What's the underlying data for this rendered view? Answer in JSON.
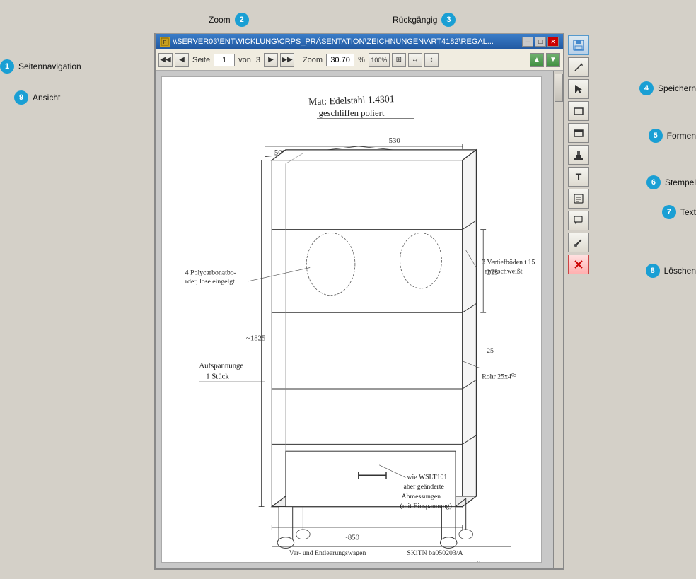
{
  "window": {
    "title": "\\\\SERVER03\\ENTWICKLUNG\\CRPS_PRÄSENTATION\\ZEICHNUNGEN\\ART4182\\REGAL...",
    "icon": "📄"
  },
  "toolbar": {
    "page_label": "Seite",
    "page_current": "1",
    "page_of_label": "von",
    "page_total": "3",
    "zoom_label": "Zoom",
    "zoom_value": "30.70",
    "zoom_percent": "%",
    "btn_first": "◀◀",
    "btn_prev": "◀",
    "btn_next": "▶",
    "btn_last": "▶▶",
    "btn_100": "100%"
  },
  "annotations": {
    "zoom_top": {
      "number": "2",
      "label": "Zoom"
    },
    "rueckgaengig": {
      "number": "3",
      "label": "Rückgängig"
    },
    "seitennavigation": {
      "number": "1",
      "label": "Seitennavigation"
    },
    "ansicht": {
      "number": "9",
      "label": "Ansicht"
    },
    "speichern": {
      "number": "4",
      "label": "Speichern"
    },
    "formen": {
      "number": "5",
      "label": "Formen"
    },
    "stempel": {
      "number": "6",
      "label": "Stempel"
    },
    "text": {
      "number": "7",
      "label": "Text"
    },
    "loeschen": {
      "number": "8",
      "label": "Löschen"
    }
  },
  "right_toolbar": {
    "btns": [
      {
        "id": "save",
        "icon": "💾",
        "label": "save-button"
      },
      {
        "id": "pen",
        "icon": "✏",
        "label": "pen-button"
      },
      {
        "id": "select",
        "icon": "↗",
        "label": "select-button"
      },
      {
        "id": "rect-empty",
        "icon": "▭",
        "label": "rectangle-button"
      },
      {
        "id": "rect-filled",
        "icon": "▬",
        "label": "rectangle-filled-button"
      },
      {
        "id": "stamp",
        "icon": "🔖",
        "label": "stamp-button"
      },
      {
        "id": "text",
        "icon": "T",
        "label": "text-button"
      },
      {
        "id": "note",
        "icon": "📋",
        "label": "note-button"
      },
      {
        "id": "callout",
        "icon": "💬",
        "label": "callout-button"
      },
      {
        "id": "tool",
        "icon": "⚒",
        "label": "tool-button"
      },
      {
        "id": "delete",
        "icon": "✖",
        "label": "delete-button",
        "style": "red"
      }
    ]
  }
}
